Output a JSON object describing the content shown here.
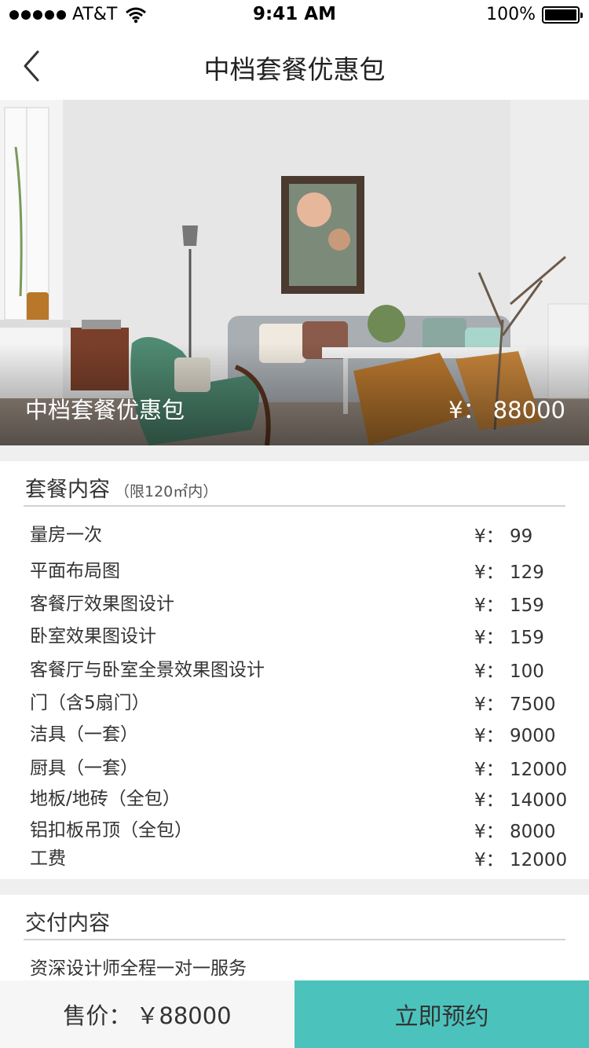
{
  "status_bar": {
    "carrier": "AT&T",
    "time": "9:41 AM",
    "battery": "100%",
    "battery_level": 1.0
  },
  "nav": {
    "title": "中档套餐优惠包",
    "back_icon": "chevron-left-icon"
  },
  "hero": {
    "name": "中档套餐优惠包",
    "price": "¥： 88000"
  },
  "package": {
    "title": "套餐内容",
    "note": "（限120㎡内）",
    "items": [
      {
        "name": "量房一次",
        "price": "¥： 99"
      },
      {
        "name": "平面布局图",
        "price": "¥： 129"
      },
      {
        "name": "客餐厅效果图设计",
        "price": "¥： 159"
      },
      {
        "name": "卧室效果图设计",
        "price": "¥： 159"
      },
      {
        "name": "客餐厅与卧室全景效果图设计",
        "price": "¥： 100"
      },
      {
        "name": "门（含5扇门）",
        "price": "¥： 7500"
      },
      {
        "name": "洁具（一套）",
        "price": "¥： 9000"
      },
      {
        "name": "厨具（一套）",
        "price": "¥： 12000"
      },
      {
        "name": "地板/地砖（全包）",
        "price": "¥： 14000"
      },
      {
        "name": "铝扣板吊顶（全包）",
        "price": "¥： 8000"
      },
      {
        "name": "工费",
        "price": "¥： 12000"
      }
    ]
  },
  "delivery": {
    "title": "交付内容",
    "items": [
      "资深设计师全程一对一服务"
    ]
  },
  "bottom": {
    "price_label": "售价：",
    "price_value": "￥88000",
    "book_label": "立即预约"
  },
  "colors": {
    "accent": "#4bc3bc",
    "background": "#efefef"
  }
}
